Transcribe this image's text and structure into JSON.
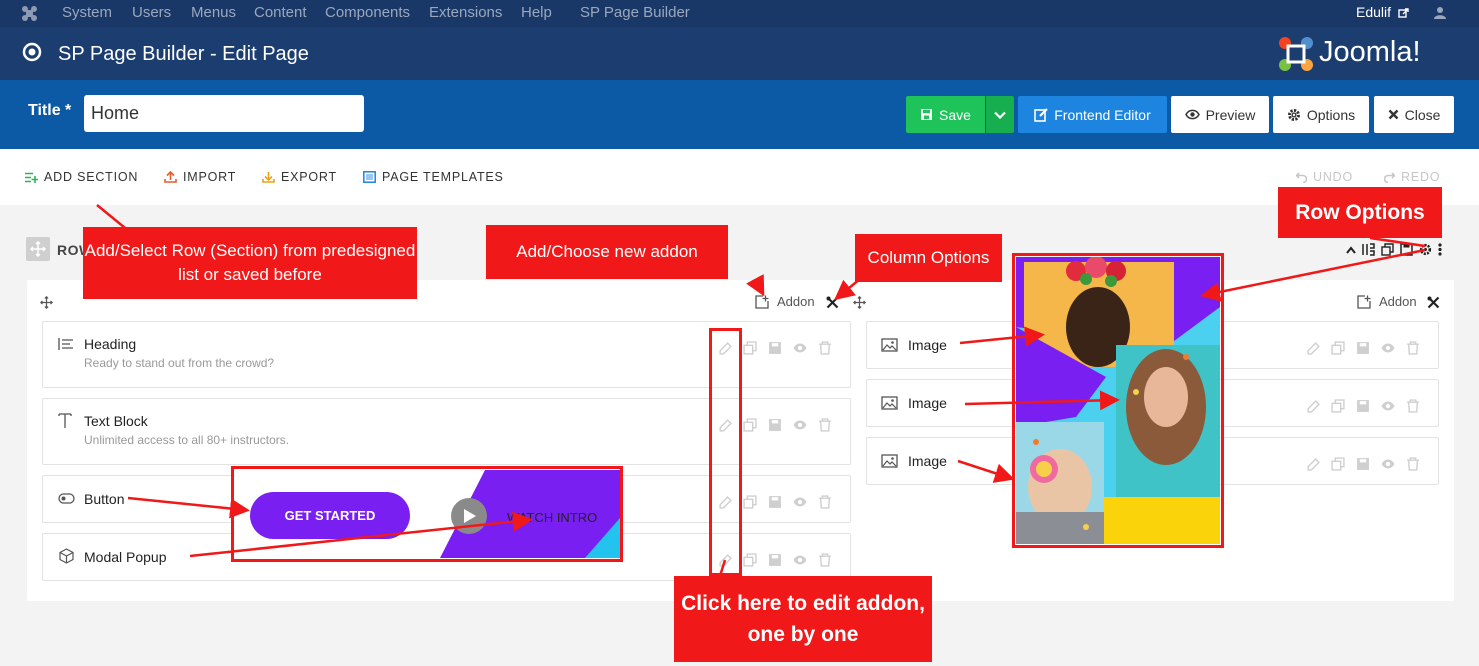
{
  "topbar": {
    "menu": [
      "System",
      "Users",
      "Menus",
      "Content",
      "Components",
      "Extensions",
      "Help",
      "SP Page Builder"
    ],
    "user": "Edulif"
  },
  "header": {
    "title": "SP Page Builder - Edit Page",
    "logo": "Joomla!"
  },
  "titlebar": {
    "label": "Title *",
    "value": "Home",
    "buttons": {
      "save": "Save",
      "frontend": "Frontend Editor",
      "preview": "Preview",
      "options": "Options",
      "close": "Close"
    }
  },
  "toolbar": {
    "add_section": "ADD SECTION",
    "import": "IMPORT",
    "export": "EXPORT",
    "templates": "PAGE TEMPLATES",
    "undo": "UNDO",
    "redo": "REDO"
  },
  "row": {
    "label": "ROW"
  },
  "column_left": {
    "addon_label": "Addon",
    "addons": [
      {
        "name": "Heading",
        "desc": "Ready to stand out from the crowd?"
      },
      {
        "name": "Text Block",
        "desc": "Unlimited access to all 80+ instructors."
      },
      {
        "name": "Button",
        "desc": ""
      },
      {
        "name": "Modal Popup",
        "desc": ""
      }
    ]
  },
  "column_right": {
    "addon_label": "Addon",
    "addons": [
      {
        "name": "Image"
      },
      {
        "name": "Image"
      },
      {
        "name": "Image"
      }
    ]
  },
  "preview": {
    "get_started": "GET STARTED",
    "watch_intro": "WATCH INTRO"
  },
  "callouts": {
    "add_row": "Add/Select Row (Section) from predesigned list or saved before",
    "add_addon": "Add/Choose new addon",
    "column_options": "Column Options",
    "row_options": "Row Options",
    "edit_addon": "Click here to edit addon, one by one"
  },
  "colors": {
    "admin_bar": "#1a3867",
    "header": "#1c3d6f",
    "title_bar": "#0c5aa6",
    "save": "#1ec35a",
    "frontend": "#1d84df",
    "callout": "#f01818",
    "purple": "#7a1ff2"
  }
}
